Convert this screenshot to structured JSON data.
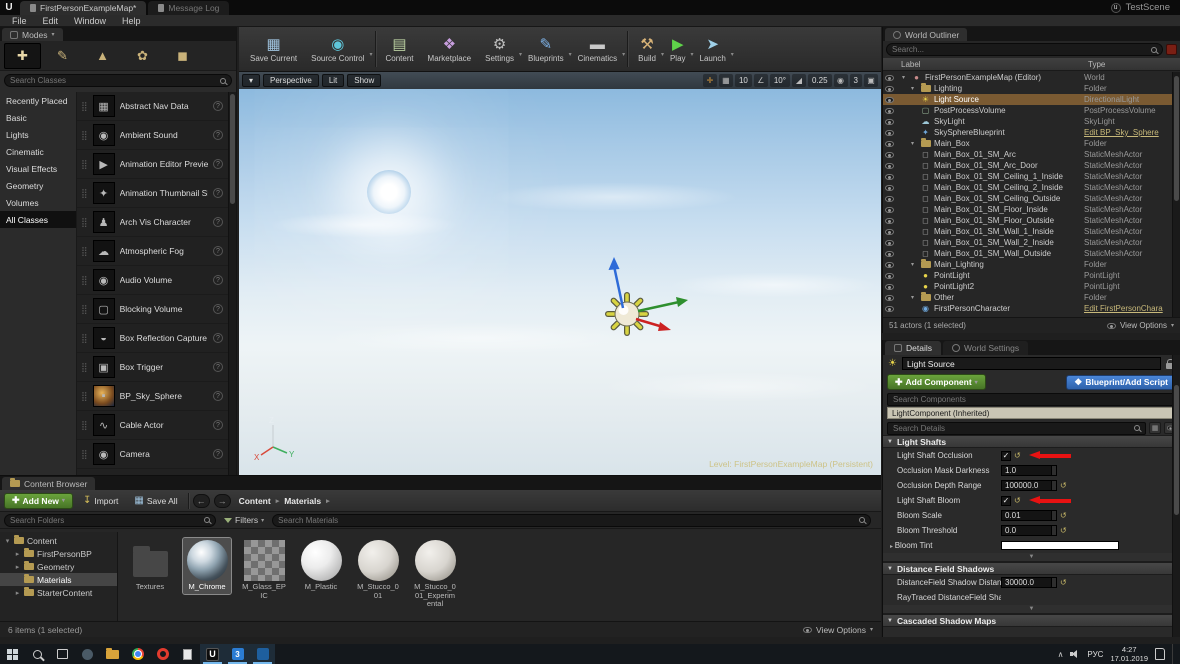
{
  "colors": {
    "selection_highlight": "#7a5a32",
    "add_button_green": "#477427",
    "script_button_blue": "#2f62ab",
    "annotation_red": "#e81212",
    "blueprint_link": "#c8b97a",
    "taskbar_accent": "#76b9ed"
  },
  "window": {
    "tabs": [
      {
        "label": "FirstPersonExampleMap*",
        "active": true
      },
      {
        "label": "Message Log",
        "active": false
      }
    ],
    "project_name": "TestScene"
  },
  "menu": [
    "File",
    "Edit",
    "Window",
    "Help"
  ],
  "modes": {
    "header": "Modes",
    "search_placeholder": "Search Classes",
    "tools": [
      "place-mode",
      "paint-mode",
      "landscape-mode",
      "foliage-mode",
      "geometry-mode"
    ],
    "categories": [
      {
        "label": "Recently Placed"
      },
      {
        "label": "Basic"
      },
      {
        "label": "Lights"
      },
      {
        "label": "Cinematic"
      },
      {
        "label": "Visual Effects"
      },
      {
        "label": "Geometry"
      },
      {
        "label": "Volumes"
      },
      {
        "label": "All Classes",
        "selected": true
      }
    ],
    "classes": [
      {
        "label": "Abstract Nav Data",
        "icon": "nav"
      },
      {
        "label": "Ambient Sound",
        "icon": "sound"
      },
      {
        "label": "Animation Editor Preview Actor",
        "icon": "preview"
      },
      {
        "label": "Animation Thumbnail Skeletal Mes",
        "icon": "skeleton"
      },
      {
        "label": "Arch Vis Character",
        "icon": "character"
      },
      {
        "label": "Atmospheric Fog",
        "icon": "fog"
      },
      {
        "label": "Audio Volume",
        "icon": "audio"
      },
      {
        "label": "Blocking Volume",
        "icon": "volume"
      },
      {
        "label": "Box Reflection Capture",
        "icon": "capture"
      },
      {
        "label": "Box Trigger",
        "icon": "trigger"
      },
      {
        "label": "BP_Sky_Sphere",
        "icon": "sky"
      },
      {
        "label": "Cable Actor",
        "icon": "cable"
      },
      {
        "label": "Camera",
        "icon": "camera"
      }
    ]
  },
  "toolbar": [
    {
      "label": "Save Current",
      "dropdown": false,
      "sep_after": false
    },
    {
      "label": "Source Control",
      "dropdown": true,
      "sep_after": true
    },
    {
      "label": "Content",
      "dropdown": false,
      "sep_after": false
    },
    {
      "label": "Marketplace",
      "dropdown": false,
      "sep_after": false
    },
    {
      "label": "Settings",
      "dropdown": true,
      "sep_after": false
    },
    {
      "label": "Blueprints",
      "dropdown": true,
      "sep_after": false
    },
    {
      "label": "Cinematics",
      "dropdown": true,
      "sep_after": true
    },
    {
      "label": "Build",
      "dropdown": true,
      "sep_after": false
    },
    {
      "label": "Play",
      "dropdown": true,
      "sep_after": false
    },
    {
      "label": "Launch",
      "dropdown": true,
      "sep_after": false
    }
  ],
  "viewport": {
    "perspective_label": "Perspective",
    "lit_label": "Lit",
    "show_label": "Show",
    "grid_snap_value": "10",
    "rotation_snap_value": "10°",
    "scale_snap_value": "0.25",
    "camera_speed_value": "3",
    "level_label": "Level:  FirstPersonExampleMap (Persistent)"
  },
  "outliner": {
    "title": "World Outliner",
    "search_placeholder": "Search...",
    "columns": [
      "Label",
      "Type"
    ],
    "rows": [
      {
        "label": "FirstPersonExampleMap (Editor)",
        "type": "World",
        "indent": 0,
        "icon": "world",
        "expander": true
      },
      {
        "label": "Lighting",
        "type": "Folder",
        "indent": 1,
        "icon": "folder",
        "expander": true
      },
      {
        "label": "Light Source",
        "type": "DirectionalLight",
        "indent": 2,
        "icon": "sun",
        "selected": true
      },
      {
        "label": "PostProcessVolume",
        "type": "PostProcessVolume",
        "indent": 2,
        "icon": "box"
      },
      {
        "label": "SkyLight",
        "type": "SkyLight",
        "indent": 2,
        "icon": "skylight"
      },
      {
        "label": "SkySphereBlueprint",
        "type": "Edit BP_Sky_Sphere",
        "indent": 2,
        "icon": "blueprint",
        "link": true
      },
      {
        "label": "Main_Box",
        "type": "Folder",
        "indent": 1,
        "icon": "folder",
        "expander": true
      },
      {
        "label": "Main_Box_01_SM_Arc",
        "type": "StaticMeshActor",
        "indent": 2,
        "icon": "mesh"
      },
      {
        "label": "Main_Box_01_SM_Arc_Door",
        "type": "StaticMeshActor",
        "indent": 2,
        "icon": "mesh"
      },
      {
        "label": "Main_Box_01_SM_Ceiling_1_Inside",
        "type": "StaticMeshActor",
        "indent": 2,
        "icon": "mesh"
      },
      {
        "label": "Main_Box_01_SM_Ceiling_2_Inside",
        "type": "StaticMeshActor",
        "indent": 2,
        "icon": "mesh"
      },
      {
        "label": "Main_Box_01_SM_Ceiling_Outside",
        "type": "StaticMeshActor",
        "indent": 2,
        "icon": "mesh"
      },
      {
        "label": "Main_Box_01_SM_Floor_Inside",
        "type": "StaticMeshActor",
        "indent": 2,
        "icon": "mesh"
      },
      {
        "label": "Main_Box_01_SM_Floor_Outside",
        "type": "StaticMeshActor",
        "indent": 2,
        "icon": "mesh"
      },
      {
        "label": "Main_Box_01_SM_Wall_1_Inside",
        "type": "StaticMeshActor",
        "indent": 2,
        "icon": "mesh"
      },
      {
        "label": "Main_Box_01_SM_Wall_2_Inside",
        "type": "StaticMeshActor",
        "indent": 2,
        "icon": "mesh"
      },
      {
        "label": "Main_Box_01_SM_Wall_Outside",
        "type": "StaticMeshActor",
        "indent": 2,
        "icon": "mesh"
      },
      {
        "label": "Main_Lighting",
        "type": "Folder",
        "indent": 1,
        "icon": "folder",
        "expander": true
      },
      {
        "label": "PointLight",
        "type": "PointLight",
        "indent": 2,
        "icon": "bulb"
      },
      {
        "label": "PointLight2",
        "type": "PointLight",
        "indent": 2,
        "icon": "bulb"
      },
      {
        "label": "Other",
        "type": "Folder",
        "indent": 1,
        "icon": "folder",
        "expander": true
      },
      {
        "label": "FirstPersonCharacter",
        "type": "Edit FirstPersonChara",
        "indent": 2,
        "icon": "character",
        "link": true
      }
    ],
    "footer": "51 actors (1 selected)",
    "view_options_label": "View Options"
  },
  "details": {
    "tabs": [
      {
        "label": "Details",
        "active": true
      },
      {
        "label": "World Settings",
        "active": false
      }
    ],
    "actor_name": "Light Source",
    "add_component_label": "Add Component",
    "add_script_label": "Blueprint/Add Script",
    "search_components_placeholder": "Search Components",
    "component_row": "LightComponent (Inherited)",
    "search_details_placeholder": "Search Details",
    "sections": [
      {
        "title": "Light Shafts",
        "rows": [
          {
            "label": "Light Shaft Occlusion",
            "control": "checkbox",
            "checked": true,
            "reset": true,
            "annotated": true
          },
          {
            "label": "Occlusion Mask Darkness",
            "control": "number",
            "value": "1.0"
          },
          {
            "label": "Occlusion Depth Range",
            "control": "number",
            "value": "100000.0",
            "reset": true
          },
          {
            "label": "Light Shaft Bloom",
            "control": "checkbox",
            "checked": true,
            "reset": true,
            "annotated": true
          },
          {
            "label": "Bloom Scale",
            "control": "number",
            "value": "0.01",
            "reset": true
          },
          {
            "label": "Bloom Threshold",
            "control": "number",
            "value": "0.0",
            "reset": true
          },
          {
            "label": "Bloom Tint",
            "control": "color",
            "value": "#ffffff",
            "header": true
          }
        ]
      },
      {
        "title": "Distance Field Shadows",
        "rows": [
          {
            "label": "DistanceField Shadow Distan",
            "control": "number",
            "value": "30000.0",
            "reset": true
          },
          {
            "label": "RayTraced DistanceField Sha",
            "control": "none"
          }
        ]
      },
      {
        "title": "Cascaded Shadow Maps",
        "rows": []
      }
    ]
  },
  "content_browser": {
    "tab_label": "Content Browser",
    "add_new_label": "Add New",
    "import_label": "Import",
    "save_all_label": "Save All",
    "breadcrumb": [
      "Content",
      "Materials"
    ],
    "filters_label": "Filters",
    "search_folders_placeholder": "Search Folders",
    "search_assets_placeholder": "Search Materials",
    "tree": [
      {
        "label": "Content",
        "indent": 0,
        "caret": "open"
      },
      {
        "label": "FirstPersonBP",
        "indent": 1,
        "caret": "closed"
      },
      {
        "label": "Geometry",
        "indent": 1,
        "caret": "closed"
      },
      {
        "label": "Materials",
        "indent": 1,
        "caret": "none",
        "selected": true
      },
      {
        "label": "StarterContent",
        "indent": 1,
        "caret": "closed"
      }
    ],
    "assets": [
      {
        "name": "Textures",
        "kind": "folder"
      },
      {
        "name": "M_Chrome",
        "kind": "chrome",
        "selected": true
      },
      {
        "name": "M_Glass_EPIC",
        "kind": "glass"
      },
      {
        "name": "M_Plastic",
        "kind": "plastic"
      },
      {
        "name": "M_Stucco_001",
        "kind": "stucco"
      },
      {
        "name": "M_Stucco_001_Experimental",
        "kind": "stucco"
      }
    ],
    "footer": "6 items (1 selected)",
    "view_options_label": "View Options"
  },
  "taskbar": {
    "icons": [
      {
        "name": "start"
      },
      {
        "name": "search"
      },
      {
        "name": "task-view"
      },
      {
        "name": "headset"
      },
      {
        "name": "explorer-folder"
      },
      {
        "name": "chrome"
      },
      {
        "name": "opera"
      },
      {
        "name": "notepad"
      },
      {
        "name": "unreal",
        "open": true
      },
      {
        "name": "app-3",
        "open": true
      },
      {
        "name": "media-player",
        "open": true
      }
    ],
    "lang": "РУС",
    "time": "4:27",
    "date": "17.01.2019"
  }
}
